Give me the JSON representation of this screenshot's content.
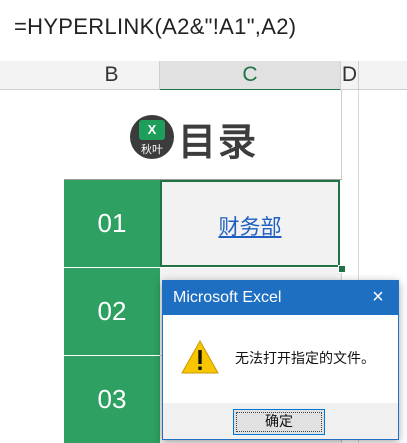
{
  "formula_bar": {
    "formula": "=HYPERLINK(A2&\"!A1\",A2)"
  },
  "columns": [
    {
      "label": "B"
    },
    {
      "label": "C"
    },
    {
      "label": "D"
    }
  ],
  "title_cell": {
    "logo_label": "X",
    "logo_sub": "秋叶",
    "title": "目录"
  },
  "rows": [
    {
      "num": "01",
      "link": "财务部"
    },
    {
      "num": "02"
    },
    {
      "num": "03"
    }
  ],
  "dialog": {
    "title": "Microsoft Excel",
    "close_icon": "×",
    "message": "无法打开指定的文件。",
    "ok_label": "确定",
    "icon": "warning-icon"
  },
  "colors": {
    "green": "#2ea061",
    "excel_green": "#217346",
    "link": "#1f5fbf",
    "dialog_title": "#1e6fc2"
  }
}
